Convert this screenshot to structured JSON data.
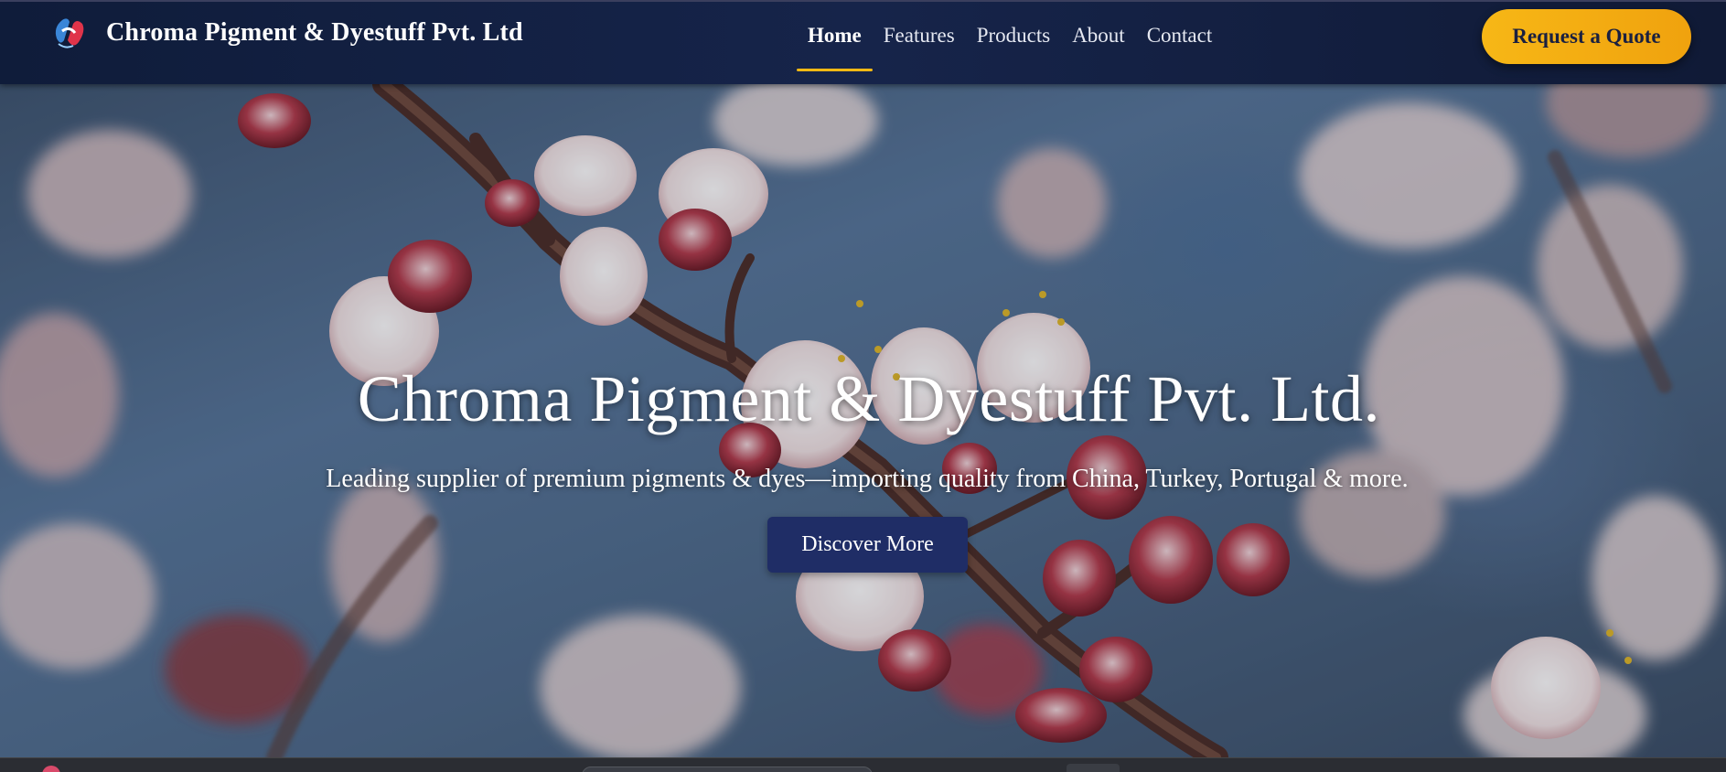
{
  "navbar": {
    "brand_name": "Chroma Pigment & Dyestuff Pvt. Ltd",
    "logo_icon": "chroma-logo-icon",
    "links": [
      {
        "label": "Home",
        "active": true
      },
      {
        "label": "Features",
        "active": false
      },
      {
        "label": "Products",
        "active": false
      },
      {
        "label": "About",
        "active": false
      },
      {
        "label": "Contact",
        "active": false
      }
    ],
    "cta_label": "Request a Quote"
  },
  "hero": {
    "title": "Chroma Pigment & Dyestuff Pvt. Ltd.",
    "subtitle": "Leading supplier of premium pigments & dyes—importing quality from China, Turkey, Portugal & more.",
    "button_label": "Discover More",
    "background_image": "cherry-blossom-branch-photo"
  },
  "colors": {
    "nav_bg": "#12204a",
    "accent": "#f5b914",
    "button_primary": "#1f2d66",
    "text_light": "#ffffff"
  }
}
